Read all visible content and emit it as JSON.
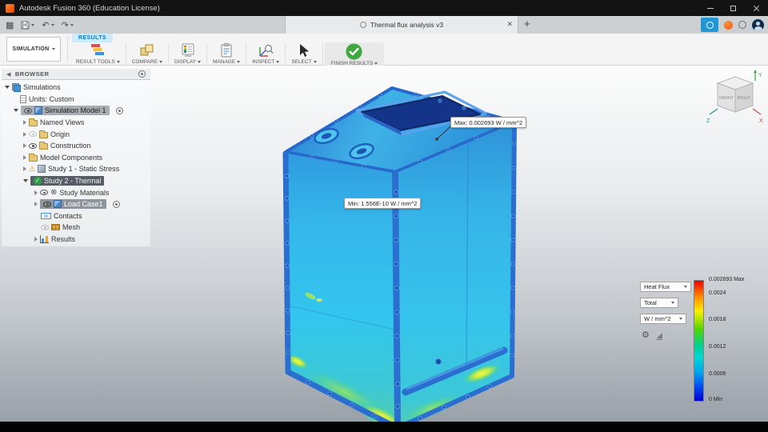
{
  "icons": {
    "back": "◀",
    "menu_grid": "▦",
    "undo": "↶",
    "redo": "↷",
    "close_tab": "✕",
    "new_tab": "+",
    "gear": "⚙",
    "plot": "◢",
    "check": "✓",
    "warning": "⚠",
    "materials": "⊗"
  },
  "titlebar": {
    "title": "Autodesk Fusion 360 (Education License)"
  },
  "tabbar": {
    "document_title": "Thermal flux analysis v3"
  },
  "ribbon": {
    "workspace": "SIMULATION",
    "active_tab": "RESULTS",
    "groups": [
      "RESULT TOOLS",
      "COMPARE",
      "DISPLAY",
      "MANAGE",
      "INSPECT",
      "SELECT",
      "FINISH RESULTS"
    ]
  },
  "browser": {
    "header": "BROWSER",
    "items": [
      {
        "label": "Simulations"
      },
      {
        "label": "Units: Custom"
      },
      {
        "label": "Simulation Model 1"
      },
      {
        "label": "Named Views"
      },
      {
        "label": "Origin"
      },
      {
        "label": "Construction"
      },
      {
        "label": "Model Components"
      },
      {
        "label": "Study 1 - Static Stress"
      },
      {
        "label": "Study 2 - Thermal"
      },
      {
        "label": "Study Materials"
      },
      {
        "label": "Load Case1"
      },
      {
        "label": "Contacts"
      },
      {
        "label": "Mesh"
      },
      {
        "label": "Results"
      }
    ]
  },
  "viewport": {
    "max_annotation": "Max: 0.002693 W / mm^2",
    "min_annotation": "Min: 1.556E-10 W / mm^2",
    "viewcube": {
      "front": "FRONT",
      "right": "RIGHT",
      "x": "X",
      "y": "Y",
      "z": "Z"
    }
  },
  "legend": {
    "result_type": "Heat Flux",
    "component": "Total",
    "unit": "W / mm^2",
    "ticks": [
      "0.002693 Max",
      "0.0024",
      "0.0018",
      "0.0012",
      "0.0006",
      "0 Min"
    ]
  }
}
